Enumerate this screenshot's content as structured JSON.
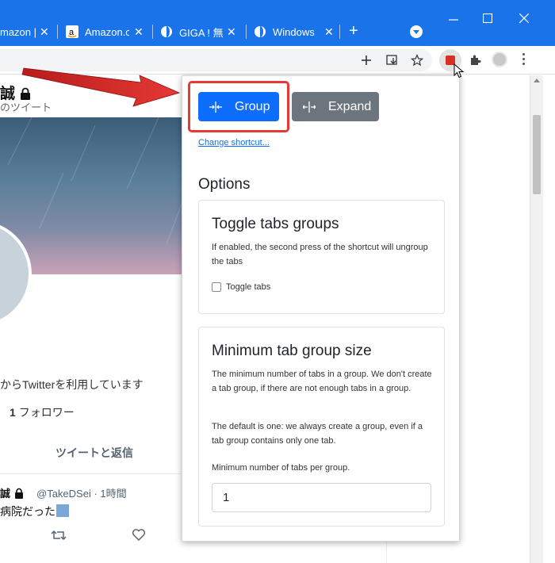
{
  "browser": {
    "tabs": [
      {
        "label": "mazon | ",
        "favicon": "amazon-icon"
      },
      {
        "label": "Amazon.c",
        "favicon": "amazon-icon"
      },
      {
        "label": "GIGA ! 無",
        "favicon": "globe-icon"
      },
      {
        "label": "Windows",
        "favicon": "globe-icon"
      }
    ],
    "new_tab": "+",
    "close_glyph": "✕"
  },
  "popup": {
    "group_label": "Group",
    "expand_label": "Expand",
    "change_shortcut": "Change shortcut...",
    "options_title": "Options",
    "toggle_card": {
      "title": "Toggle tabs groups",
      "description": "If enabled, the second press of the shortcut will ungroup the tabs",
      "checkbox_label": "Toggle tabs",
      "checked": false
    },
    "min_size_card": {
      "title": "Minimum tab group size",
      "description": "The minimum number of tabs in a group. We don't create a tab group, if there are not enough tabs in a group.",
      "default_note": "The default is one: we always create a group, even if a tab group contains only one tab.",
      "field_label": "Minimum number of tabs per group.",
      "field_value": "1"
    }
  },
  "twitter": {
    "name": "誠",
    "subtitle": "のツイート",
    "bio": "からTwitterを利用しています",
    "followers_count": "1",
    "followers_label": "フォロワー",
    "tab_label": "ツイートと返信",
    "tweet_author": "誠",
    "tweet_handle": "@TakeDSei · 1時間",
    "tweet_text": "病院だった"
  },
  "colors": {
    "chrome_blue": "#1a73e8",
    "primary": "#0d6efd",
    "secondary": "#6c757d",
    "highlight_red": "#e53935"
  }
}
